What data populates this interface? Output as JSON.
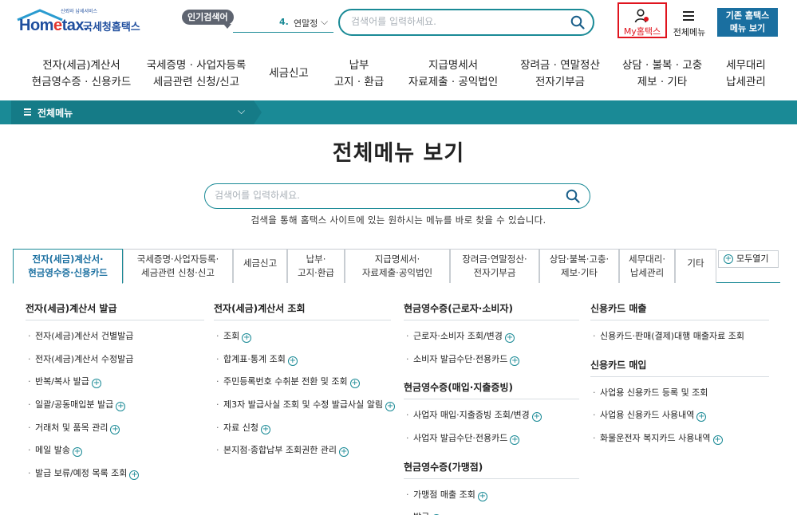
{
  "header": {
    "logo_brand_a": "Hom",
    "logo_brand_e": "e",
    "logo_brand_b": "tax.",
    "logo_tagline": "신뢰와 납세서비스",
    "logo_org": "국세청홈택스",
    "popular_badge": "인기검색어",
    "popular_rank": "4.",
    "popular_keyword": "연말정산",
    "search_placeholder": "검색어를 입력하세요.",
    "my_hometax": "My홈택스",
    "all_menu": "전체메뉴",
    "legacy_line1": "기존 홈택스",
    "legacy_line2": "메뉴 보기"
  },
  "gnb": [
    "전자(세금)계산서\n현금영수증 · 신용카드",
    "국세증명 · 사업자등록\n세금관련 신청/신고",
    "세금신고",
    "납부\n고지 · 환급",
    "지급명세서\n자료제출 · 공익법인",
    "장려금 · 연말정산\n전자기부금",
    "상담 · 불복 · 고충\n제보 · 기타",
    "세무대리\n납세관리"
  ],
  "location": {
    "label": "전체메뉴"
  },
  "page_title": "전체메뉴 보기",
  "main_search": {
    "placeholder": "검색어를 입력하세요.",
    "hint": "검색을 통해 홈택스 사이트에 있는 원하시는 메뉴를 바로 찾을 수 있습니다."
  },
  "tabs": [
    "전자(세금)계산서·\n현금영수증·신용카드",
    "국세증명·사업자등록·\n세금관련 신청·신고",
    "세금신고",
    "납부·\n고지·환급",
    "지급명세서·\n자료제출·공익법인",
    "장려금·연말정산·\n전자기부금",
    "상담·불복·고충·\n제보·기타",
    "세무대리·\n납세관리",
    "기타"
  ],
  "expand_all": "모두열기",
  "columns": [
    {
      "sections": [
        {
          "title": "전자(세금)계산서 발급",
          "items": [
            {
              "label": "전자(세금)계산서 건별발급",
              "plus": false
            },
            {
              "label": "전자(세금)계산서 수정발급",
              "plus": false
            },
            {
              "label": "반복/복사 발급",
              "plus": true
            },
            {
              "label": "일괄/공동매입분 발급",
              "plus": true
            },
            {
              "label": "거래처 및 품목 관리",
              "plus": true
            },
            {
              "label": "메일 발송",
              "plus": true
            },
            {
              "label": "발급 보류/예정 목록 조회",
              "plus": true
            }
          ]
        }
      ]
    },
    {
      "sections": [
        {
          "title": "전자(세금)계산서 조회",
          "items": [
            {
              "label": "조회",
              "plus": true
            },
            {
              "label": "합계표·통계 조회",
              "plus": true
            },
            {
              "label": "주민등록번호 수취분 전환 및 조회",
              "plus": true
            },
            {
              "label": "제3자 발급사실 조회 및 수정 발급사실 알림",
              "plus": true
            },
            {
              "label": "자료 신청",
              "plus": true
            },
            {
              "label": "본지점·종합납부 조회권한 관리",
              "plus": true
            }
          ]
        }
      ]
    },
    {
      "sections": [
        {
          "title": "현금영수증(근로자·소비자)",
          "items": [
            {
              "label": "근로자·소비자 조회/변경",
              "plus": true
            },
            {
              "label": "소비자 발급수단·전용카드",
              "plus": true
            }
          ]
        },
        {
          "title": "현금영수증(매입·지출증빙)",
          "items": [
            {
              "label": "사업자 매입·지출증빙 조회/변경",
              "plus": true
            },
            {
              "label": "사업자 발급수단·전용카드",
              "plus": true
            }
          ]
        },
        {
          "title": "현금영수증(가맹점)",
          "items": [
            {
              "label": "가맹점 매출 조회",
              "plus": true
            },
            {
              "label": "발급",
              "plus": true
            }
          ]
        }
      ]
    },
    {
      "sections": [
        {
          "title": "신용카드 매출",
          "items": [
            {
              "label": "신용카드·판매(결제)대행 매출자료 조회",
              "plus": false
            }
          ]
        },
        {
          "title": "신용카드 매입",
          "items": [
            {
              "label": "사업용 신용카드 등록 및 조회",
              "plus": false
            },
            {
              "label": "사업용 신용카드 사용내역",
              "plus": true
            },
            {
              "label": "화물운전자 복지카드 사용내역",
              "plus": true
            }
          ]
        }
      ]
    }
  ],
  "colors": {
    "teal": "#1a8a96",
    "red": "#e0141e",
    "blue": "#1a6fa0"
  }
}
